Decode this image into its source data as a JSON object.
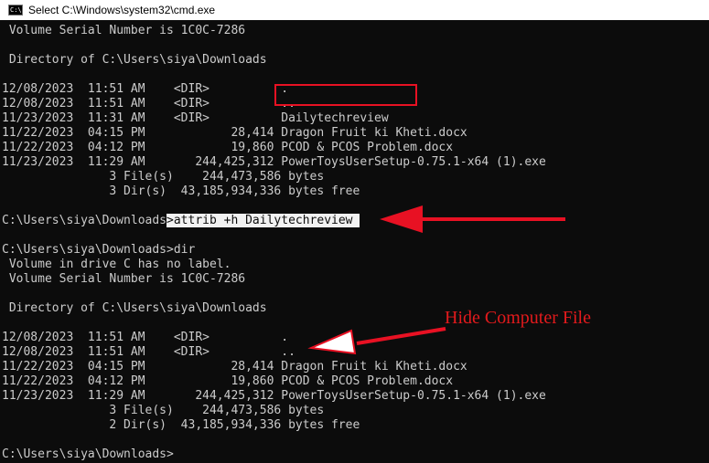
{
  "window": {
    "title": "Select C:\\Windows\\system32\\cmd.exe",
    "icon": "cmd-icon",
    "icon_text": "C:\\"
  },
  "colors": {
    "console_bg": "#0c0c0c",
    "console_text": "#cccccc",
    "annotation_red": "#e31a1c"
  },
  "console": {
    "lines": [
      {
        "text": " Volume Serial Number is 1C0C-7286"
      },
      {
        "text": ""
      },
      {
        "text": " Directory of C:\\Users\\siya\\Downloads"
      },
      {
        "text": ""
      },
      {
        "text": "12/08/2023  11:51 AM    <DIR>          ."
      },
      {
        "text": "12/08/2023  11:51 AM    <DIR>          .."
      },
      {
        "text": "11/23/2023  11:31 AM    <DIR>          Dailytechreview"
      },
      {
        "text": "11/22/2023  04:15 PM            28,414 Dragon Fruit ki Kheti.docx"
      },
      {
        "text": "11/22/2023  04:12 PM            19,860 PCOD & PCOS Problem.docx"
      },
      {
        "text": "11/23/2023  11:29 AM       244,425,312 PowerToysUserSetup-0.75.1-x64 (1).exe"
      },
      {
        "text": "               3 File(s)    244,473,586 bytes"
      },
      {
        "text": "               3 Dir(s)  43,185,934,336 bytes free"
      },
      {
        "text": ""
      },
      {
        "text": "C:\\Users\\siya\\Downloads",
        "highlight": ">attrib +h Dailytechreview "
      },
      {
        "text": ""
      },
      {
        "text": "C:\\Users\\siya\\Downloads>dir"
      },
      {
        "text": " Volume in drive C has no label."
      },
      {
        "text": " Volume Serial Number is 1C0C-7286"
      },
      {
        "text": ""
      },
      {
        "text": " Directory of C:\\Users\\siya\\Downloads"
      },
      {
        "text": ""
      },
      {
        "text": "12/08/2023  11:51 AM    <DIR>          ."
      },
      {
        "text": "12/08/2023  11:51 AM    <DIR>          .."
      },
      {
        "text": "11/22/2023  04:15 PM            28,414 Dragon Fruit ki Kheti.docx"
      },
      {
        "text": "11/22/2023  04:12 PM            19,860 PCOD & PCOS Problem.docx"
      },
      {
        "text": "11/23/2023  11:29 AM       244,425,312 PowerToysUserSetup-0.75.1-x64 (1).exe"
      },
      {
        "text": "               3 File(s)    244,473,586 bytes"
      },
      {
        "text": "               2 Dir(s)  43,185,934,336 bytes free"
      },
      {
        "text": ""
      },
      {
        "text": "C:\\Users\\siya\\Downloads>"
      }
    ]
  },
  "annotations": {
    "label": "Hide Computer File",
    "arrow_icon": "red-arrow-icon",
    "outline_arrow_icon": "red-outline-arrow-icon",
    "box": "red-highlight-box"
  }
}
